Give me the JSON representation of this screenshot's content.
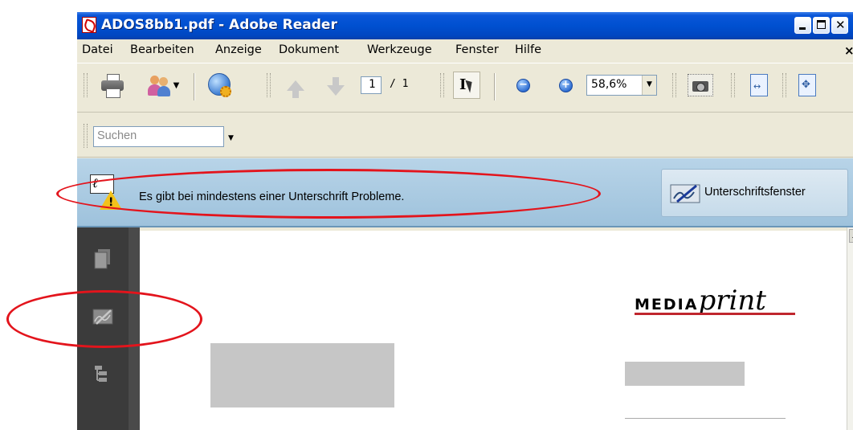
{
  "window": {
    "title": "ADOS8bb1.pdf - Adobe Reader",
    "controls": {
      "minimize_icon": "minimize-icon",
      "maximize_icon": "maximize-icon",
      "close_icon": "close-icon"
    }
  },
  "menubar": {
    "items": [
      "Datei",
      "Bearbeiten",
      "Anzeige",
      "Dokument",
      "Werkzeuge",
      "Fenster",
      "Hilfe"
    ],
    "close_glyph": "×"
  },
  "toolbar": {
    "page_current": "1",
    "page_total": "/ 1",
    "zoom_value": "58,6%",
    "icons": [
      "print-icon",
      "collaborate-icon",
      "secure-icon",
      "previous-page-icon",
      "next-page-icon",
      "select-tool-icon",
      "zoom-out-icon",
      "zoom-in-icon",
      "snapshot-icon",
      "fit-width-icon",
      "fit-page-icon"
    ]
  },
  "search": {
    "placeholder": "Suchen"
  },
  "signature_bar": {
    "message": "Es gibt bei mindestens einer Unterschrift Probleme.",
    "button_label": "Unterschriftsfenster",
    "warning_icon": "signature-warning-icon"
  },
  "side_panel": {
    "icons": [
      "pages-icon",
      "signatures-icon",
      "bookmarks-icon"
    ]
  },
  "document": {
    "logo_bold": "MEDIA",
    "logo_italic": "print",
    "colors": {
      "logo_accent": "#c0262e",
      "placeholder_block": "#c6c6c6"
    }
  },
  "annotations": {
    "color": "#e3141c",
    "shape": "ellipse",
    "highlighted": [
      "signature-message",
      "signatures-panel-icon"
    ]
  },
  "colors": {
    "titlebar": "#0050d0",
    "chrome": "#ece9d8",
    "signature_bar": "#b8d4e8",
    "side_panel": "#3b3b3b"
  }
}
